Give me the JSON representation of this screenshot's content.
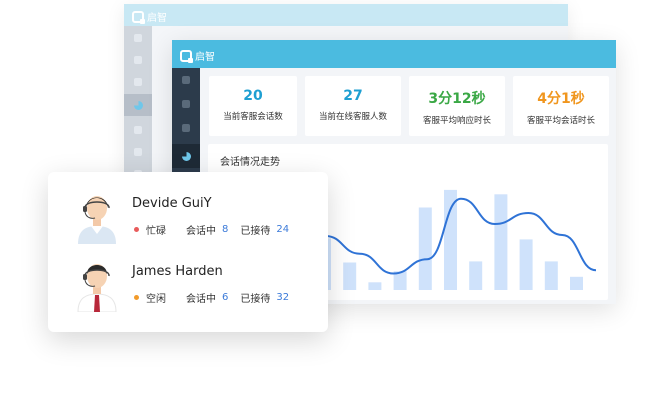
{
  "app": {
    "logo_text": "启智"
  },
  "stats": [
    {
      "value": "20",
      "label": "当前客服会话数",
      "color": "#1e9fd2"
    },
    {
      "value": "27",
      "label": "当前在线客服人数",
      "color": "#1e9fd2"
    },
    {
      "value": "3分12秒",
      "label": "客服平均响应时长",
      "color": "#3aa845"
    },
    {
      "value": "4分1秒",
      "label": "客服平均会话时长",
      "color": "#f0961e"
    }
  ],
  "chart_title": "会话情况走势",
  "chart_data": {
    "type": "bar",
    "bar_values": [
      0.47,
      0.25,
      0.07,
      0.17,
      0.75,
      0.91,
      0.26,
      0.87,
      0.46,
      0.26,
      0.12
    ],
    "line_values": [
      0.49,
      0.33,
      0.15,
      0.28,
      0.83,
      0.6,
      0.7,
      0.5,
      0.18
    ],
    "bar_color": "#cfe2fb",
    "line_color": "#2f73d6",
    "grid": false,
    "legend": "none"
  },
  "agents": [
    {
      "name": "Devide GuiY",
      "status": "忙碌",
      "status_color": "#e85b5b",
      "in_session_label": "会话中",
      "in_session": "8",
      "received_label": "已接待",
      "received": "24",
      "avatar": "female-agent-avatar"
    },
    {
      "name": "James Harden",
      "status": "空闲",
      "status_color": "#f29b2b",
      "in_session_label": "会话中",
      "in_session": "6",
      "received_label": "已接待",
      "received": "32",
      "avatar": "male-agent-avatar"
    }
  ]
}
